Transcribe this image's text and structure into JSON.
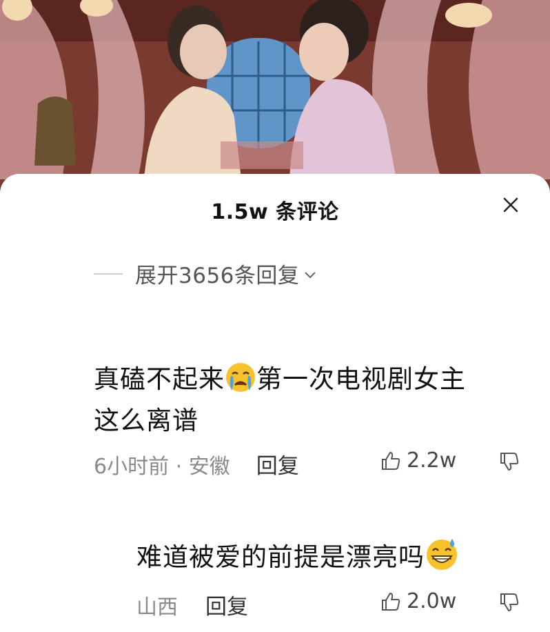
{
  "header": {
    "title": "1.5w 条评论"
  },
  "thread": {
    "expand_replies_label": "展开3656条回复"
  },
  "comments": [
    {
      "text_before_emoji": "真磕不起来",
      "emoji": "crying-face-emoji",
      "text_after_emoji_line1": "第一次电视剧女主",
      "text_line2": "这么离谱",
      "time_location": "6小时前 · 安徽",
      "reply_label": "回复",
      "likes": "2.2w"
    },
    {
      "text": "难道被爱的前提是漂亮吗",
      "emoji": "grinning-sweat-emoji",
      "location": "山西",
      "reply_label": "回复",
      "likes": "2.0w"
    }
  ],
  "colors": {
    "title": "#111111",
    "meta": "#8a8a8a",
    "reply": "#333333",
    "emoji_yellow": "#f7c22c",
    "emoji_tear": "#4aa3e8"
  }
}
